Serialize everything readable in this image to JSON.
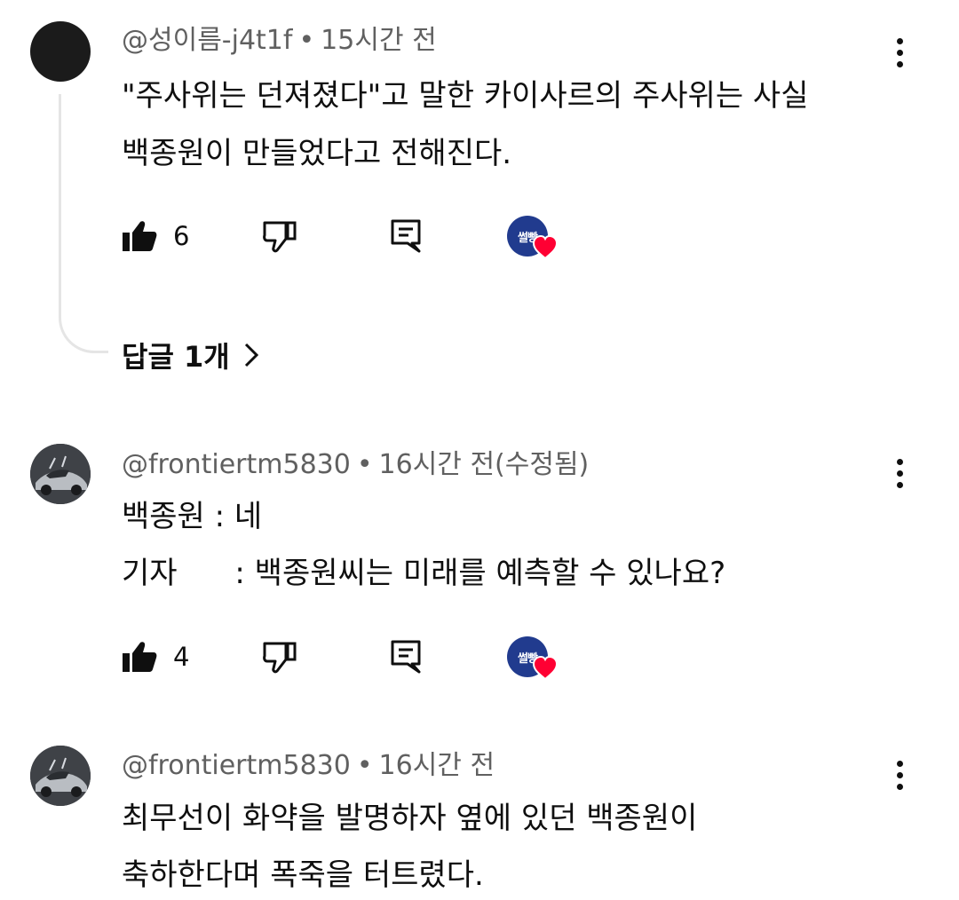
{
  "comments": [
    {
      "author": "@성이름-j4t1f",
      "time": "15시간 전",
      "lines": [
        "\"주사위는 던져졌다\"고 말한 카이사르의 주사위는 사실",
        "백종원이 만들었다고 전해진다."
      ],
      "likes": "6",
      "avatar": "black-circle",
      "replies_label": "답글 1개"
    },
    {
      "author": "@frontiertm5830",
      "time": "16시간 전(수정됨)",
      "lines": [
        "백종원 : 네",
        "기자      : 백종원씨는 미래를 예측할 수 있나요?"
      ],
      "likes": "4",
      "avatar": "car-photo"
    },
    {
      "author": "@frontiertm5830",
      "time": "16시간 전",
      "lines": [
        "최무선이 화약을 발명하자 옆에 있던 백종원이",
        "축하한다며 폭죽을 터트렸다."
      ],
      "avatar": "car-photo"
    }
  ],
  "creator_badge_text": "썰빵",
  "icons": [
    "like-icon",
    "dislike-icon",
    "reply-icon",
    "more-vert-icon",
    "heart-icon",
    "chevron-right-icon"
  ],
  "colors": {
    "heart": "#ff0033",
    "creator_avatar": "#213b8e",
    "meta_text": "#606060"
  }
}
